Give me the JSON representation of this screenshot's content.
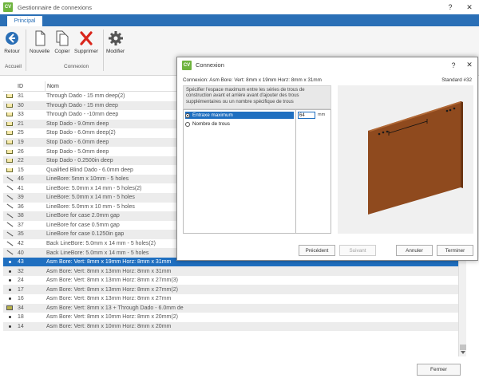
{
  "window": {
    "logo": "CV",
    "title": "Gestionnaire de connexions",
    "help": "?",
    "close": "✕"
  },
  "ribbon": {
    "tab": "Principal",
    "buttons": {
      "retour": "Retour",
      "nouvelle": "Nouvelle",
      "copier": "Copier",
      "supprimer": "Supprimer",
      "modifier": "Modifier"
    },
    "groups": {
      "accueil": "Accueil",
      "connexion": "Connexion"
    }
  },
  "table": {
    "headers": {
      "id": "ID",
      "nom": "Nom"
    },
    "rows": [
      {
        "icon": "dado",
        "id": "31",
        "nom": "Through Dado - 15 mm deep(2)"
      },
      {
        "icon": "dado",
        "id": "30",
        "nom": "Through Dado - 15 mm deep"
      },
      {
        "icon": "dado",
        "id": "33",
        "nom": "Through Dado - -10mm deep"
      },
      {
        "icon": "dado",
        "id": "21",
        "nom": "Stop Dado - 9.0mm deep"
      },
      {
        "icon": "dado",
        "id": "25",
        "nom": "Stop Dado - 6.0mm deep(2)"
      },
      {
        "icon": "dado",
        "id": "19",
        "nom": "Stop Dado - 6.0mm deep"
      },
      {
        "icon": "dado",
        "id": "26",
        "nom": "Stop Dado - 5.0mm deep"
      },
      {
        "icon": "dado",
        "id": "22",
        "nom": "Stop Dado - 0.2500in deep"
      },
      {
        "icon": "dado",
        "id": "15",
        "nom": "Qualified Blind Dado - 6.0mm deep"
      },
      {
        "icon": "line",
        "id": "46",
        "nom": "LineBore: 5mm x 10mm - 5 holes"
      },
      {
        "icon": "line",
        "id": "41",
        "nom": "LineBore: 5.0mm x 14 mm - 5 holes(2)"
      },
      {
        "icon": "line",
        "id": "39",
        "nom": "LineBore: 5.0mm x 14 mm - 5 holes"
      },
      {
        "icon": "line",
        "id": "36",
        "nom": "LineBore: 5.0mm x 10 mm - 5 holes"
      },
      {
        "icon": "line",
        "id": "38",
        "nom": "LineBore for case 2.0mm gap"
      },
      {
        "icon": "line",
        "id": "37",
        "nom": "LineBore for case 0.5mm gap"
      },
      {
        "icon": "line",
        "id": "35",
        "nom": "LineBore for case 0.1250in gap"
      },
      {
        "icon": "line",
        "id": "42",
        "nom": "Back LineBore: 5.0mm x 14 mm - 5 holes(2)"
      },
      {
        "icon": "line",
        "id": "40",
        "nom": "Back LineBore: 5.0mm x 14 mm - 5 holes"
      },
      {
        "icon": "dot",
        "id": "43",
        "nom": "Asm Bore: Vert: 8mm x 19mm Horz: 8mm x 31mm"
      },
      {
        "icon": "dot",
        "id": "32",
        "nom": "Asm Bore: Vert: 8mm x 13mm Horz: 8mm x 31mm"
      },
      {
        "icon": "dot",
        "id": "24",
        "nom": "Asm Bore: Vert: 8mm x 13mm Horz: 8mm x 27mm(3)"
      },
      {
        "icon": "dot",
        "id": "17",
        "nom": "Asm Bore: Vert: 8mm x 13mm Horz: 8mm x 27mm(2)"
      },
      {
        "icon": "dot",
        "id": "16",
        "nom": "Asm Bore: Vert: 8mm x 13mm Horz: 8mm x 27mm"
      },
      {
        "icon": "dado2",
        "id": "34",
        "nom": "Asm Bore: Vert: 8mm x 13 + Through Dado - 6.0mm de"
      },
      {
        "icon": "dot",
        "id": "18",
        "nom": "Asm Bore: Vert: 8mm x 10mm Horz: 8mm x 20mm(2)"
      },
      {
        "icon": "dot",
        "id": "14",
        "nom": "Asm Bore: Vert: 8mm x 10mm Horz: 8mm x 20mm"
      }
    ],
    "selected_id": "43"
  },
  "footer": {
    "close_label": "Fermer"
  },
  "dialog": {
    "logo": "CV",
    "title": "Connexion",
    "help": "?",
    "close": "✕",
    "connection_label": "Connexion: Asm Bore: Vert: 8mm x 19mm Horz: 8mm x 31mm",
    "standard_label": "Standard #32",
    "description": "Spécifier l'espace maximum entre les séries de trous de construction avant et arrière avant d'ajouter des trous supplémentaires ou un nombre spécifique de trous",
    "options": [
      {
        "label": "Entraxe maximum",
        "selected": true
      },
      {
        "label": "Nombre de trous",
        "selected": false
      }
    ],
    "value": "64",
    "unit": "mm",
    "buttons": {
      "precedent": "Précédent",
      "suivant": "Suivant",
      "annuler": "Annuler",
      "terminer": "Terminer"
    }
  },
  "colors": {
    "accent": "#2a6fb6",
    "selection": "#1f6fc0",
    "logo": "#6fb43f",
    "board": "#8f4a1e"
  }
}
